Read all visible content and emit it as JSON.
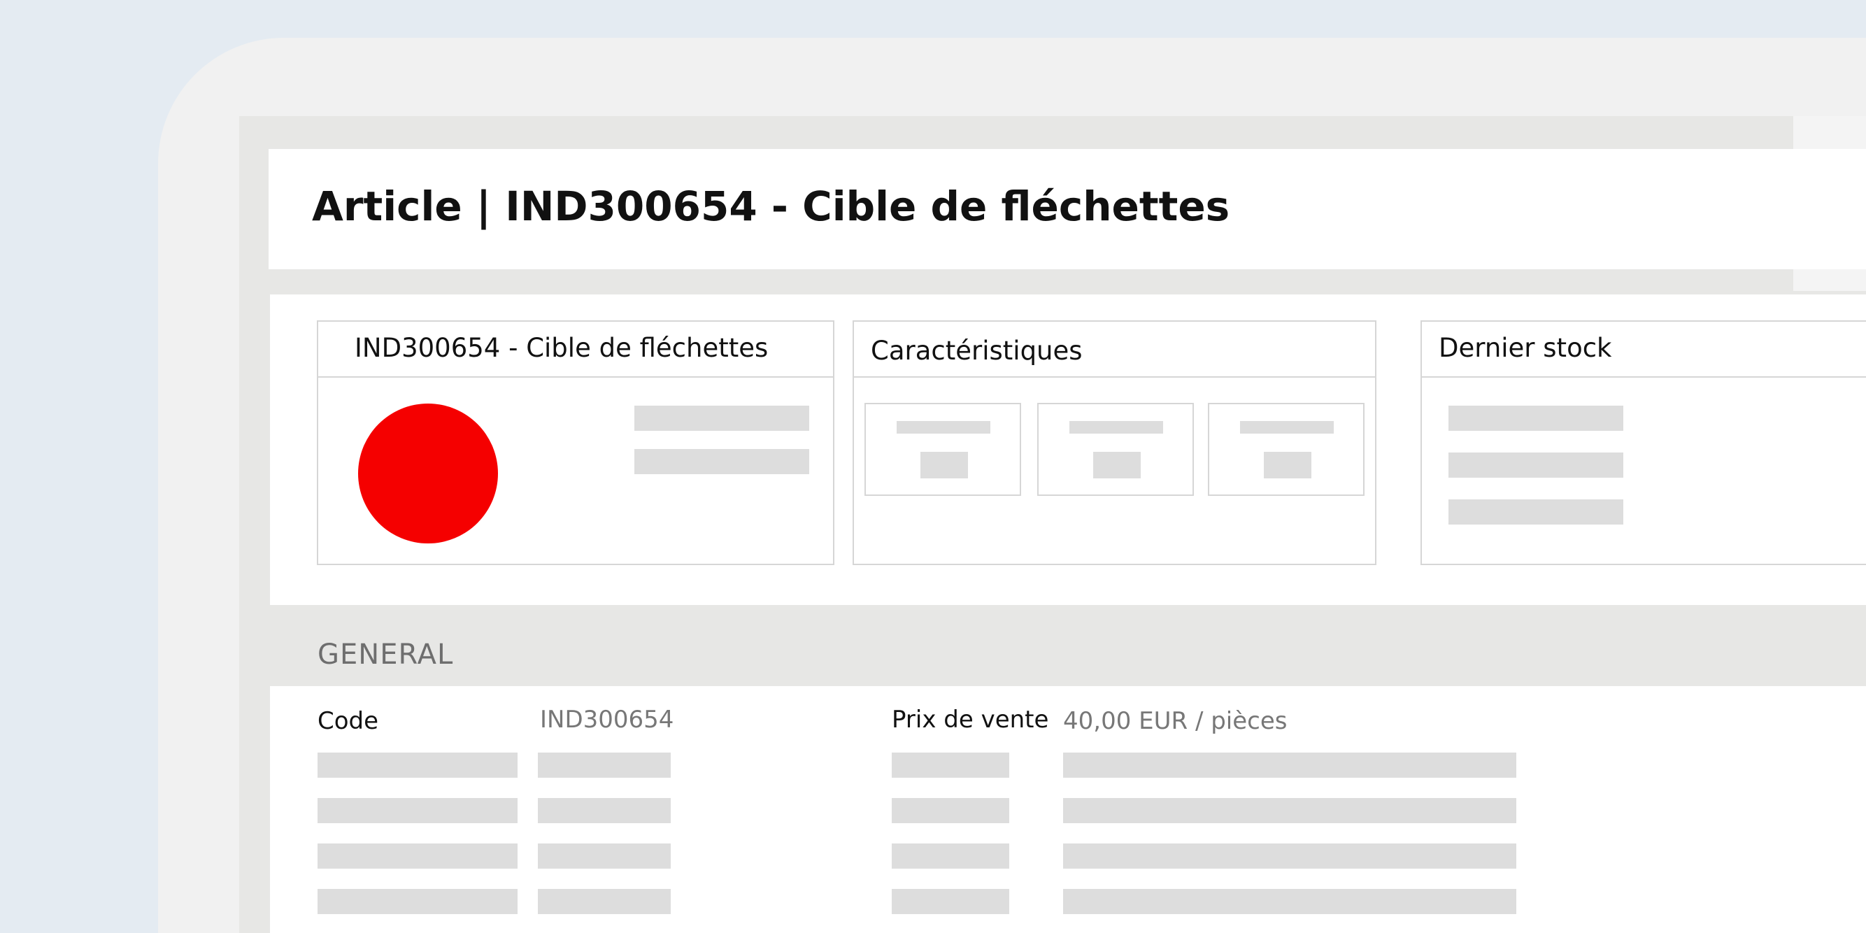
{
  "header": {
    "title": "Article  | IND300654 - Cible de fléchettes"
  },
  "cards": {
    "article": {
      "title": "IND300654 - Cible de fléchettes",
      "image_color": "#f50000"
    },
    "characteristics": {
      "title": "Caractéristiques"
    },
    "stock": {
      "title": "Dernier stock"
    }
  },
  "general": {
    "section_title": "GENERAL",
    "code_label": "Code",
    "code_value": "IND300654",
    "price_label": "Prix de vente",
    "price_value": "40,00 EUR / pièces"
  }
}
